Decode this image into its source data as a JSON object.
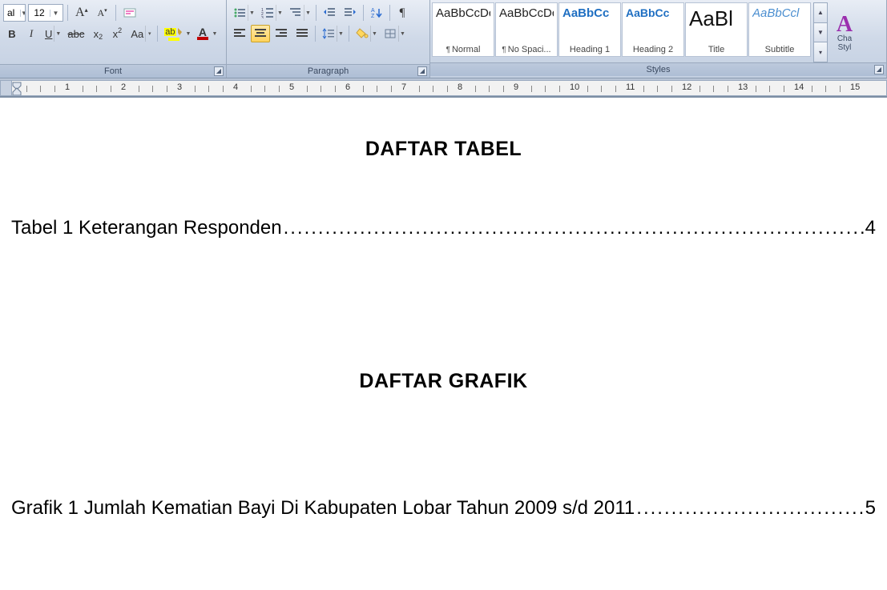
{
  "ribbon": {
    "font": {
      "label": "Font",
      "name_value": "al",
      "size_value": "12",
      "grow": "A",
      "shrink": "A",
      "bold": "B",
      "italic": "I",
      "underline": "U",
      "strike": "abc",
      "subscript": "x",
      "superscript": "x",
      "changecase": "Aa",
      "highlight": "ab",
      "fontcolor": "A"
    },
    "paragraph": {
      "label": "Paragraph",
      "sort": "A↓",
      "show_marks": "¶"
    },
    "styles": {
      "label": "Styles",
      "items": [
        {
          "preview": "AaBbCcDc",
          "caption": "¶ Normal",
          "class": ""
        },
        {
          "preview": "AaBbCcDc",
          "caption": "¶ No Spaci...",
          "class": ""
        },
        {
          "preview": "AaBbCc",
          "caption": "Heading 1",
          "class": "heading"
        },
        {
          "preview": "AaBbCc",
          "caption": "Heading 2",
          "class": "heading"
        },
        {
          "preview": "AaBl",
          "caption": "Title",
          "class": "title"
        },
        {
          "preview": "AaBbCcl",
          "caption": "Subtitle",
          "class": "subtitle"
        }
      ],
      "change_main": "A",
      "change_label1": "Cha",
      "change_label2": "Styl"
    }
  },
  "ruler": {
    "numbers": [
      "1",
      "2",
      "3",
      "4",
      "5",
      "6",
      "7",
      "8",
      "9",
      "10",
      "11",
      "12",
      "13",
      "14",
      "15"
    ]
  },
  "document": {
    "heading_tables": "DAFTAR TABEL",
    "toc_table_text": "Tabel 1 Keterangan Responden",
    "toc_table_page": "4",
    "heading_graphs": "DAFTAR GRAFIK",
    "toc_graph_text": "Grafik 1 Jumlah Kematian Bayi Di Kabupaten Lobar Tahun 2009 s/d 2011",
    "toc_graph_page": "5",
    "dots": "........................................................................................................................................................................................"
  }
}
